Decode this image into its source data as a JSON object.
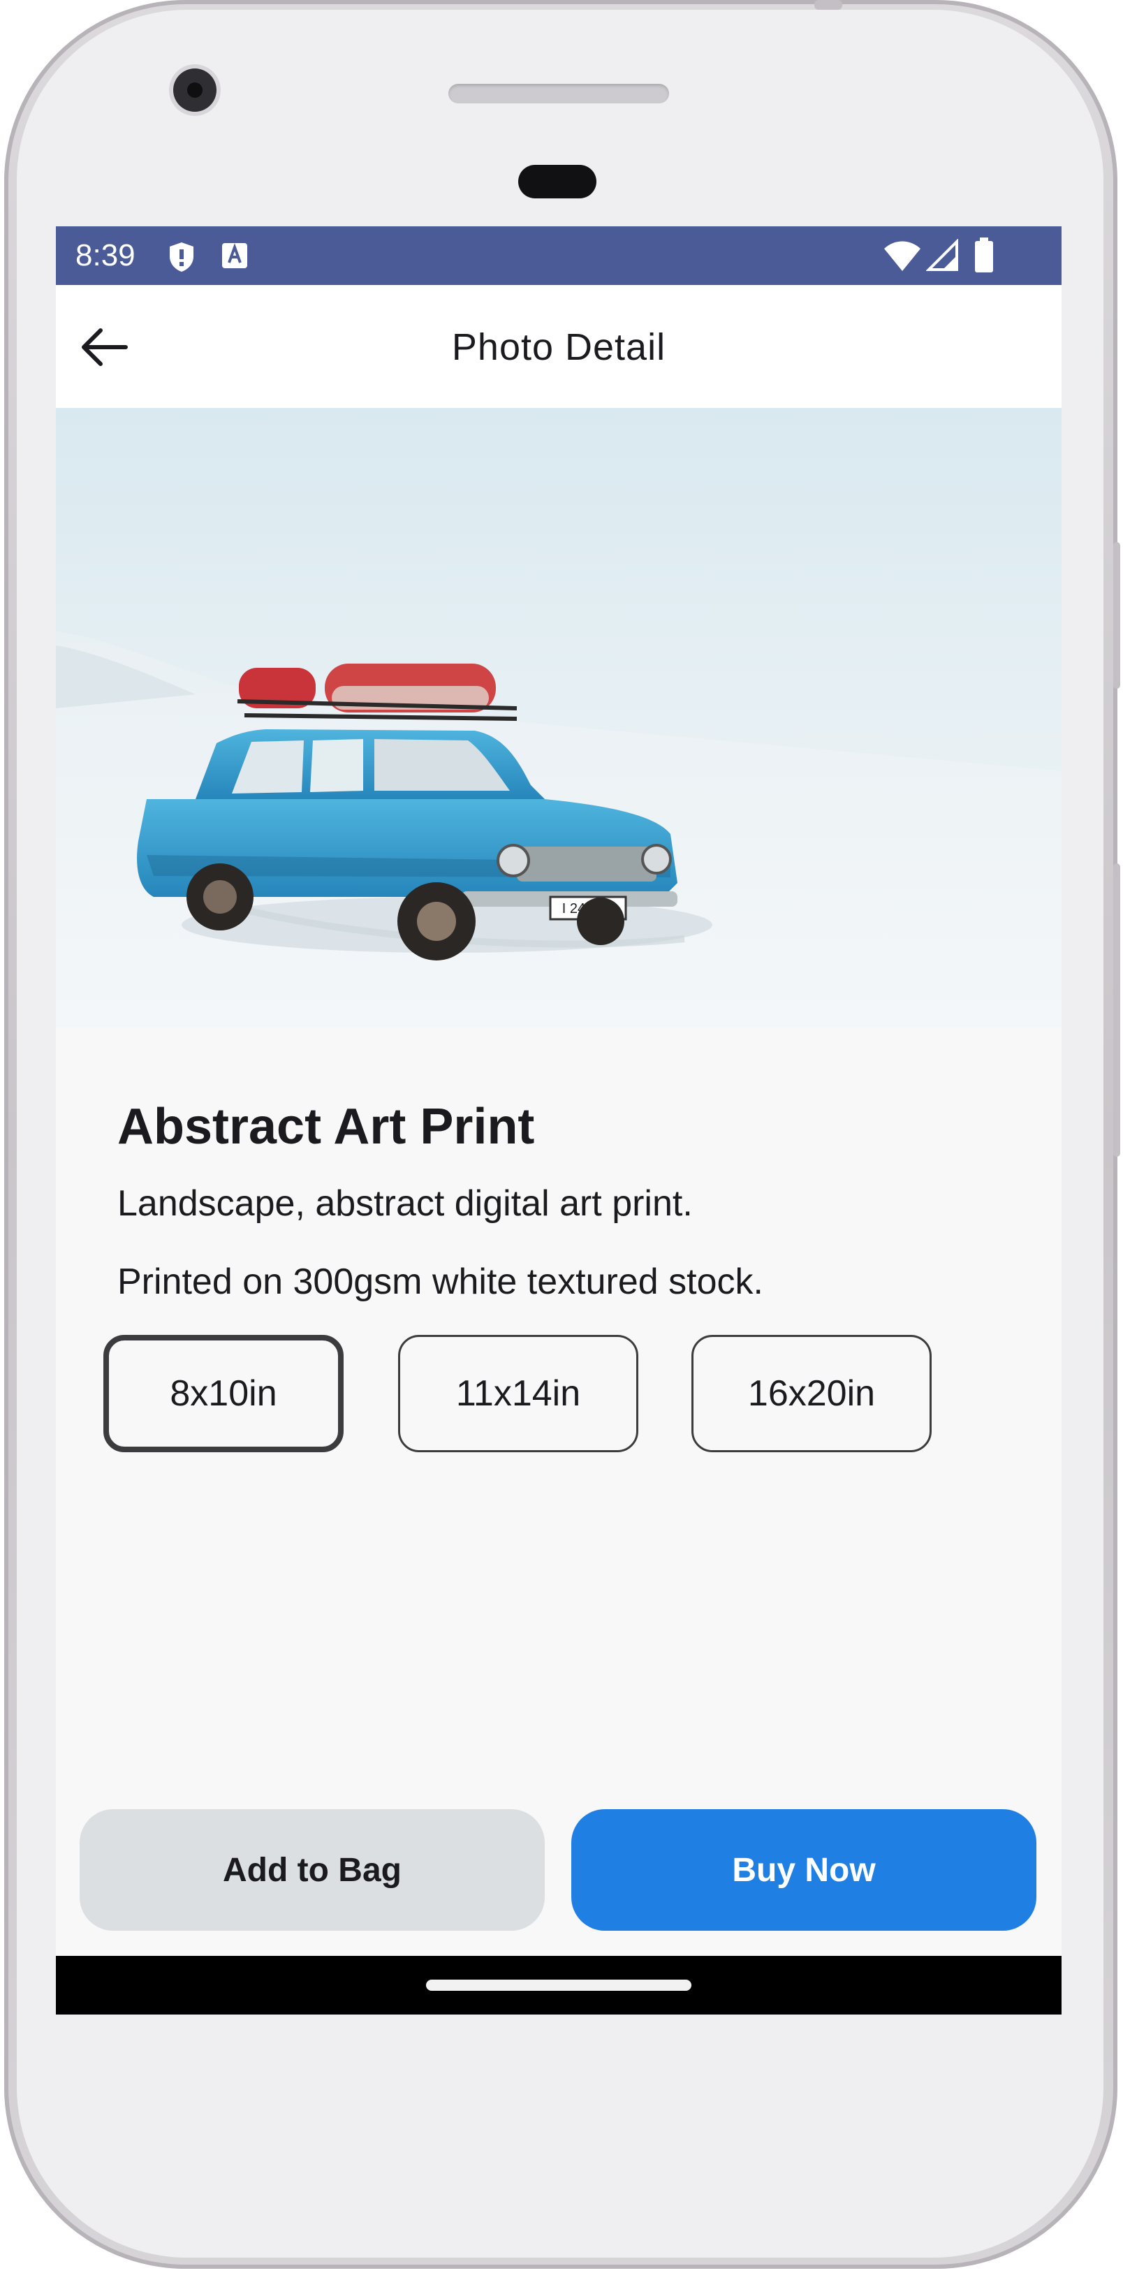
{
  "status_bar": {
    "time": "8:39",
    "icons": [
      "shield-icon",
      "keyboard-a-icon",
      "wifi-icon",
      "signal-icon",
      "battery-icon"
    ],
    "background": "#4a5b97"
  },
  "app_bar": {
    "title": "Photo Detail",
    "back_icon": "arrow-left-icon"
  },
  "product": {
    "image": "blue-vintage-car-in-snow",
    "plate_text": "I 2430 B",
    "title": "Abstract Art Print",
    "description_line1": "Landscape, abstract digital art print.",
    "description_line2": "Printed on 300gsm white textured stock.",
    "sizes": [
      {
        "label": "8x10in",
        "selected": true
      },
      {
        "label": "11x14in",
        "selected": false
      },
      {
        "label": "16x20in",
        "selected": false
      }
    ]
  },
  "actions": {
    "add_to_bag": "Add to Bag",
    "buy_now": "Buy Now",
    "buy_color": "#1f7fe3"
  }
}
